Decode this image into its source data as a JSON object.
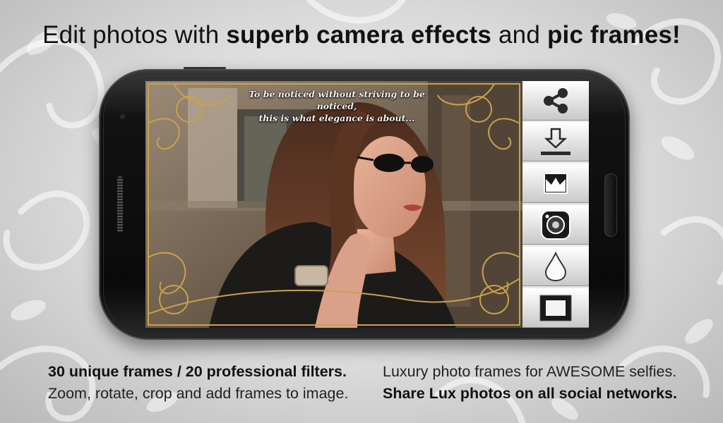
{
  "headline": {
    "part1": "Edit photos with ",
    "part2": "superb camera effects",
    "part3": " and ",
    "part4": "pic frames!"
  },
  "photo": {
    "quote_line1": "To be noticed without striving to be noticed,",
    "quote_line2": "this is what elegance is about..."
  },
  "toolbar": {
    "items": [
      {
        "label": "Share",
        "icon": "share-icon"
      },
      {
        "label": "Save",
        "icon": "download-icon"
      },
      {
        "label": "Frames",
        "icon": "frame-picker-icon"
      },
      {
        "label": "Camera effects",
        "icon": "lens-icon"
      },
      {
        "label": "Filters",
        "icon": "drop-icon"
      },
      {
        "label": "Borders",
        "icon": "border-frame-icon"
      }
    ]
  },
  "captions": {
    "left_line1": "30 unique frames / 20 professional filters.",
    "left_line2": "Zoom, rotate, crop and add frames to image.",
    "right_line1": "Luxury photo frames for AWESOME selfies.",
    "right_line2": "Share Lux photos on all social networks."
  },
  "colors": {
    "background": "#d9d9d9",
    "phone_body": "#0a0a0a",
    "frame_gold": "#c9a24a",
    "toolbar_button": "#e6e6e6"
  }
}
